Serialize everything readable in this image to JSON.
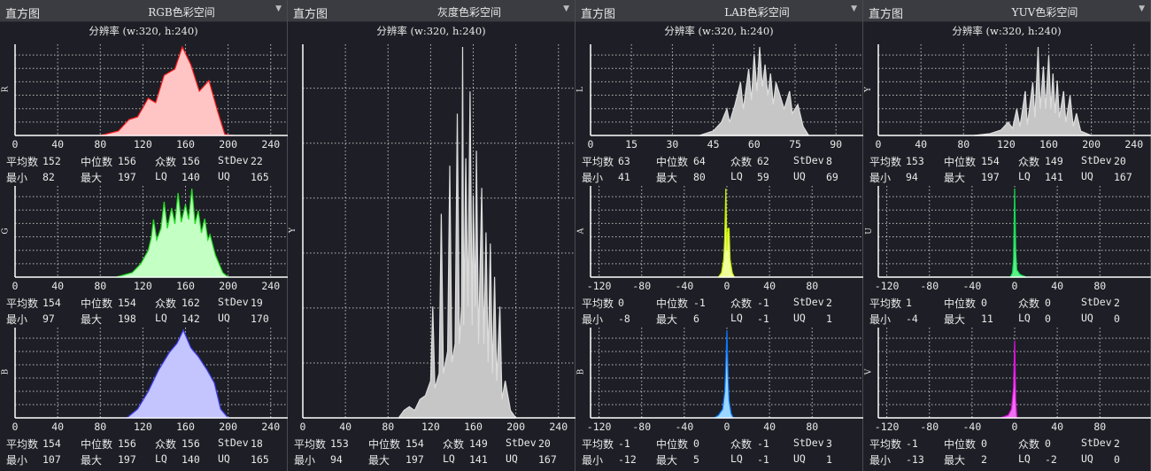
{
  "stats_labels": {
    "mean": "平均数",
    "median": "中位数",
    "mode": "众数",
    "stdev": "StDev",
    "min": "最小",
    "max": "最大",
    "lq": "LQ",
    "uq": "UQ"
  },
  "panels": [
    {
      "label": "直方图",
      "title": "RGB色彩空间",
      "resolution": "分辨率 (w:320, h:240)",
      "charts": [
        {
          "axis": "R",
          "stats": {
            "mean": "152",
            "median": "156",
            "mode": "156",
            "stdev": "22",
            "min": "82",
            "max": "197",
            "lq": "140",
            "uq": "165"
          }
        },
        {
          "axis": "G",
          "stats": {
            "mean": "154",
            "median": "154",
            "mode": "162",
            "stdev": "19",
            "min": "97",
            "max": "198",
            "lq": "142",
            "uq": "170"
          }
        },
        {
          "axis": "B",
          "stats": {
            "mean": "154",
            "median": "156",
            "mode": "156",
            "stdev": "18",
            "min": "107",
            "max": "197",
            "lq": "140",
            "uq": "165"
          }
        }
      ]
    },
    {
      "label": "直方图",
      "title": "灰度色彩空间",
      "resolution": "分辨率 (w:320, h:240)",
      "charts": [
        {
          "axis": "Y",
          "stats": {
            "mean": "153",
            "median": "154",
            "mode": "149",
            "stdev": "20",
            "min": "94",
            "max": "197",
            "lq": "141",
            "uq": "167"
          }
        }
      ]
    },
    {
      "label": "直方图",
      "title": "LAB色彩空间",
      "resolution": "分辨率 (w:320, h:240)",
      "charts": [
        {
          "axis": "L",
          "stats": {
            "mean": "63",
            "median": "64",
            "mode": "62",
            "stdev": "8",
            "min": "41",
            "max": "80",
            "lq": "59",
            "uq": "69"
          }
        },
        {
          "axis": "A",
          "stats": {
            "mean": "0",
            "median": "-1",
            "mode": "-1",
            "stdev": "2",
            "min": "-8",
            "max": "6",
            "lq": "-1",
            "uq": "1"
          }
        },
        {
          "axis": "B",
          "stats": {
            "mean": "-1",
            "median": "0",
            "mode": "-1",
            "stdev": "3",
            "min": "-12",
            "max": "5",
            "lq": "-1",
            "uq": "1"
          }
        }
      ]
    },
    {
      "label": "直方图",
      "title": "YUV色彩空间",
      "resolution": "分辨率 (w:320, h:240)",
      "charts": [
        {
          "axis": "Y",
          "stats": {
            "mean": "153",
            "median": "154",
            "mode": "149",
            "stdev": "20",
            "min": "94",
            "max": "197",
            "lq": "141",
            "uq": "167"
          }
        },
        {
          "axis": "U",
          "stats": {
            "mean": "1",
            "median": "0",
            "mode": "0",
            "stdev": "2",
            "min": "-4",
            "max": "11",
            "lq": "0",
            "uq": "0"
          }
        },
        {
          "axis": "V",
          "stats": {
            "mean": "-1",
            "median": "0",
            "mode": "0",
            "stdev": "2",
            "min": "-13",
            "max": "2",
            "lq": "-2",
            "uq": "0"
          }
        }
      ]
    }
  ],
  "chart_data": [
    {
      "type": "area",
      "panel": 0,
      "slot": 0,
      "axis": "R",
      "xlim": [
        0,
        256
      ],
      "xticks": [
        0,
        40,
        80,
        120,
        160,
        200,
        240
      ],
      "fill": "#ffc4c4",
      "stroke": "#ff1a1a",
      "points": [
        [
          80,
          0
        ],
        [
          97,
          0.05
        ],
        [
          107,
          0.18
        ],
        [
          115,
          0.21
        ],
        [
          125,
          0.42
        ],
        [
          132,
          0.37
        ],
        [
          140,
          0.68
        ],
        [
          150,
          0.75
        ],
        [
          157,
          1.0
        ],
        [
          165,
          0.8
        ],
        [
          173,
          0.5
        ],
        [
          182,
          0.62
        ],
        [
          190,
          0.28
        ],
        [
          197,
          0.01
        ],
        [
          205,
          0
        ]
      ]
    },
    {
      "type": "area",
      "panel": 0,
      "slot": 1,
      "axis": "G",
      "xlim": [
        0,
        256
      ],
      "xticks": [
        0,
        40,
        80,
        120,
        160,
        200,
        240
      ],
      "fill": "#c4ffc4",
      "stroke": "#22dd22",
      "points": [
        [
          95,
          0
        ],
        [
          110,
          0.05
        ],
        [
          118,
          0.15
        ],
        [
          125,
          0.3
        ],
        [
          128,
          0.45
        ],
        [
          130,
          0.65
        ],
        [
          133,
          0.42
        ],
        [
          137,
          0.55
        ],
        [
          140,
          0.85
        ],
        [
          143,
          0.55
        ],
        [
          147,
          0.78
        ],
        [
          150,
          0.6
        ],
        [
          153,
          0.95
        ],
        [
          156,
          0.62
        ],
        [
          160,
          0.82
        ],
        [
          163,
          0.65
        ],
        [
          166,
          1.0
        ],
        [
          169,
          0.6
        ],
        [
          172,
          0.75
        ],
        [
          175,
          0.5
        ],
        [
          178,
          0.66
        ],
        [
          181,
          0.42
        ],
        [
          183,
          0.48
        ],
        [
          188,
          0.25
        ],
        [
          195,
          0.05
        ],
        [
          200,
          0
        ]
      ]
    },
    {
      "type": "area",
      "panel": 0,
      "slot": 2,
      "axis": "B",
      "xlim": [
        0,
        256
      ],
      "xticks": [
        0,
        40,
        80,
        120,
        160,
        200,
        240
      ],
      "fill": "#c4c4ff",
      "stroke": "#4040ff",
      "points": [
        [
          105,
          0
        ],
        [
          115,
          0.1
        ],
        [
          125,
          0.3
        ],
        [
          135,
          0.55
        ],
        [
          145,
          0.75
        ],
        [
          152,
          0.85
        ],
        [
          158,
          1.0
        ],
        [
          165,
          0.8
        ],
        [
          172,
          0.7
        ],
        [
          180,
          0.55
        ],
        [
          187,
          0.4
        ],
        [
          193,
          0.1
        ],
        [
          200,
          0
        ]
      ]
    },
    {
      "type": "area",
      "panel": 1,
      "slot": 0,
      "axis": "Y",
      "xlim": [
        0,
        256
      ],
      "xticks": [
        0,
        40,
        80,
        120,
        160,
        200,
        240
      ],
      "fill": "#c6c6c6",
      "stroke": "#dddddd",
      "points": [
        [
          90,
          0
        ],
        [
          95,
          0.02
        ],
        [
          100,
          0.03
        ],
        [
          105,
          0.02
        ],
        [
          110,
          0.05
        ],
        [
          115,
          0.06
        ],
        [
          120,
          0.1
        ],
        [
          122,
          0.3
        ],
        [
          124,
          0.08
        ],
        [
          128,
          0.12
        ],
        [
          130,
          0.55
        ],
        [
          132,
          0.12
        ],
        [
          136,
          0.18
        ],
        [
          138,
          0.68
        ],
        [
          140,
          0.15
        ],
        [
          143,
          0.2
        ],
        [
          145,
          0.82
        ],
        [
          147,
          0.2
        ],
        [
          149,
          0.3
        ],
        [
          150,
          1.0
        ],
        [
          151,
          0.25
        ],
        [
          153,
          0.7
        ],
        [
          155,
          0.3
        ],
        [
          157,
          0.88
        ],
        [
          159,
          0.25
        ],
        [
          160,
          0.6
        ],
        [
          162,
          0.3
        ],
        [
          163,
          0.72
        ],
        [
          165,
          0.2
        ],
        [
          168,
          0.62
        ],
        [
          170,
          0.2
        ],
        [
          172,
          0.5
        ],
        [
          174,
          0.15
        ],
        [
          176,
          0.47
        ],
        [
          178,
          0.12
        ],
        [
          180,
          0.38
        ],
        [
          182,
          0.1
        ],
        [
          185,
          0.3
        ],
        [
          187,
          0.05
        ],
        [
          190,
          0.1
        ],
        [
          195,
          0.02
        ],
        [
          200,
          0
        ]
      ]
    },
    {
      "type": "area",
      "panel": 2,
      "slot": 0,
      "axis": "L",
      "xlim": [
        0,
        100
      ],
      "xticks": [
        0,
        15,
        30,
        45,
        60,
        75,
        90
      ],
      "fill": "#c6c6c6",
      "stroke": "#dddddd",
      "points": [
        [
          40,
          0
        ],
        [
          45,
          0.05
        ],
        [
          48,
          0.15
        ],
        [
          50,
          0.3
        ],
        [
          51,
          0.15
        ],
        [
          53,
          0.35
        ],
        [
          55,
          0.6
        ],
        [
          56,
          0.3
        ],
        [
          58,
          0.75
        ],
        [
          59,
          0.4
        ],
        [
          60,
          0.92
        ],
        [
          61,
          0.5
        ],
        [
          62,
          1.0
        ],
        [
          63,
          0.55
        ],
        [
          64,
          0.8
        ],
        [
          65,
          0.45
        ],
        [
          66,
          0.7
        ],
        [
          67,
          0.35
        ],
        [
          68,
          0.6
        ],
        [
          70,
          0.4
        ],
        [
          71,
          0.3
        ],
        [
          73,
          0.5
        ],
        [
          74,
          0.25
        ],
        [
          76,
          0.35
        ],
        [
          78,
          0.1
        ],
        [
          80,
          0
        ]
      ]
    },
    {
      "type": "area",
      "panel": 2,
      "slot": 1,
      "axis": "A",
      "xlim": [
        -128,
        128
      ],
      "xticks": [
        -120,
        -80,
        -40,
        0,
        40,
        80
      ],
      "fill": "#f0ff9a",
      "stroke": "#c8ee00",
      "points": [
        [
          -8,
          0
        ],
        [
          -5,
          0.05
        ],
        [
          -3,
          0.2
        ],
        [
          -2,
          0.45
        ],
        [
          -1,
          1.0
        ],
        [
          0,
          0.3
        ],
        [
          1,
          0.55
        ],
        [
          2,
          0.55
        ],
        [
          3,
          0.2
        ],
        [
          5,
          0.05
        ],
        [
          7,
          0
        ]
      ]
    },
    {
      "type": "area",
      "panel": 2,
      "slot": 2,
      "axis": "B",
      "xlim": [
        -128,
        128
      ],
      "xticks": [
        -120,
        -80,
        -40,
        0,
        40,
        80
      ],
      "fill": "#9ad6ff",
      "stroke": "#0a78ff",
      "points": [
        [
          -12,
          0
        ],
        [
          -8,
          0.03
        ],
        [
          -4,
          0.1
        ],
        [
          -2,
          0.3
        ],
        [
          -1,
          0.6
        ],
        [
          0,
          1.0
        ],
        [
          1,
          0.5
        ],
        [
          2,
          0.2
        ],
        [
          4,
          0.05
        ],
        [
          6,
          0
        ]
      ]
    },
    {
      "type": "area",
      "panel": 3,
      "slot": 0,
      "axis": "Y",
      "xlim": [
        0,
        256
      ],
      "xticks": [
        0,
        40,
        80,
        120,
        160,
        200,
        240
      ],
      "fill": "#c6c6c6",
      "stroke": "#dddddd",
      "points": [
        [
          90,
          0
        ],
        [
          105,
          0.02
        ],
        [
          115,
          0.06
        ],
        [
          122,
          0.15
        ],
        [
          126,
          0.08
        ],
        [
          130,
          0.3
        ],
        [
          133,
          0.1
        ],
        [
          138,
          0.5
        ],
        [
          140,
          0.12
        ],
        [
          145,
          0.6
        ],
        [
          147,
          0.2
        ],
        [
          150,
          1.0
        ],
        [
          152,
          0.3
        ],
        [
          155,
          0.78
        ],
        [
          157,
          0.3
        ],
        [
          160,
          0.9
        ],
        [
          162,
          0.3
        ],
        [
          164,
          0.7
        ],
        [
          166,
          0.25
        ],
        [
          168,
          0.62
        ],
        [
          170,
          0.2
        ],
        [
          174,
          0.5
        ],
        [
          176,
          0.15
        ],
        [
          180,
          0.45
        ],
        [
          183,
          0.1
        ],
        [
          186,
          0.25
        ],
        [
          190,
          0.05
        ],
        [
          200,
          0
        ]
      ]
    },
    {
      "type": "area",
      "panel": 3,
      "slot": 1,
      "axis": "U",
      "xlim": [
        -128,
        128
      ],
      "xticks": [
        -120,
        -80,
        -40,
        0,
        40,
        80
      ],
      "fill": "#5cf08a",
      "stroke": "#10dd50",
      "points": [
        [
          -4,
          0
        ],
        [
          -2,
          0.05
        ],
        [
          -1,
          0.2
        ],
        [
          0,
          1.0
        ],
        [
          1,
          0.3
        ],
        [
          2,
          0.08
        ],
        [
          5,
          0.03
        ],
        [
          11,
          0
        ]
      ]
    },
    {
      "type": "area",
      "panel": 3,
      "slot": 2,
      "axis": "V",
      "xlim": [
        -128,
        128
      ],
      "xticks": [
        -120,
        -80,
        -40,
        0,
        40,
        80
      ],
      "fill": "#f070f0",
      "stroke": "#e010e0",
      "points": [
        [
          -13,
          0
        ],
        [
          -6,
          0.03
        ],
        [
          -3,
          0.1
        ],
        [
          -1,
          0.35
        ],
        [
          0,
          0.88
        ],
        [
          1,
          0.2
        ],
        [
          2,
          0
        ]
      ]
    }
  ]
}
